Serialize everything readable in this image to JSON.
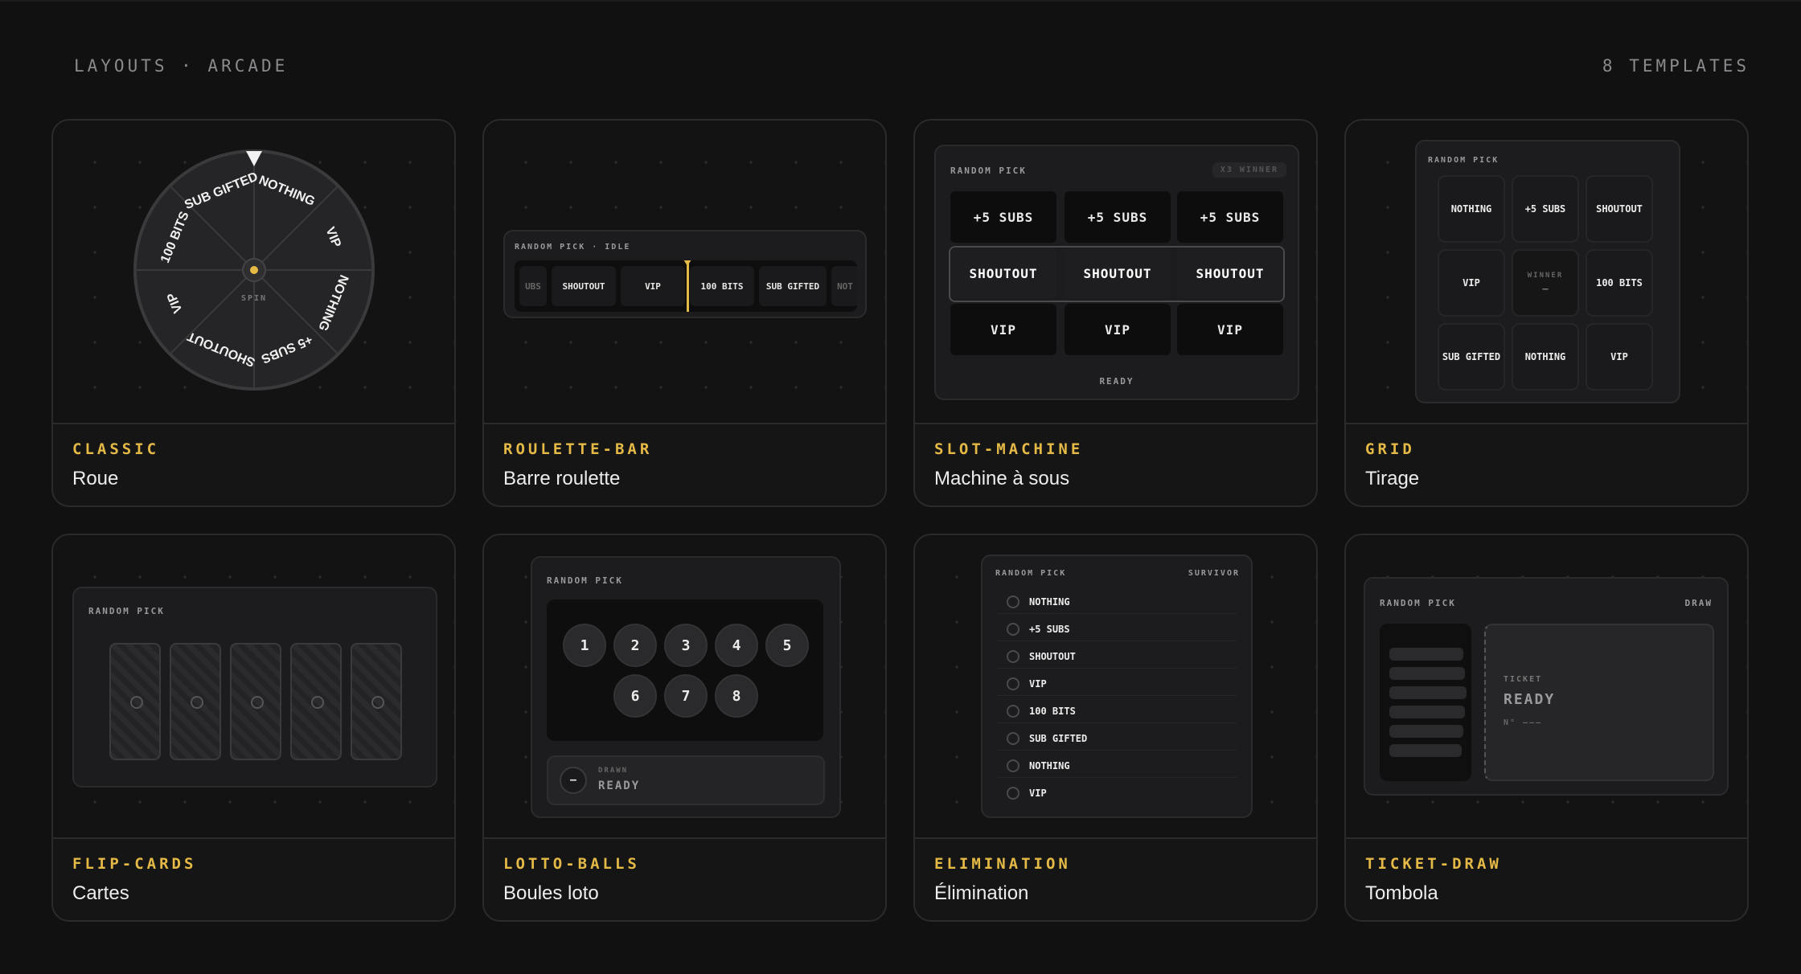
{
  "header": {
    "left": "LAYOUTS · ARCADE",
    "right": "8 TEMPLATES"
  },
  "cards": [
    {
      "tag": "CLASSIC",
      "title": "Roue"
    },
    {
      "tag": "ROULETTE-BAR",
      "title": "Barre roulette"
    },
    {
      "tag": "SLOT-MACHINE",
      "title": "Machine à sous"
    },
    {
      "tag": "GRID",
      "title": "Tirage"
    },
    {
      "tag": "FLIP-CARDS",
      "title": "Cartes"
    },
    {
      "tag": "LOTTO-BALLS",
      "title": "Boules loto"
    },
    {
      "tag": "ELIMINATION",
      "title": "Élimination"
    },
    {
      "tag": "TICKET-DRAW",
      "title": "Tombola"
    }
  ],
  "wheel": {
    "segments": [
      "NOTHING",
      "VIP",
      "NOTHING",
      "+5 SUBS",
      "SHOUTOUT",
      "VIP",
      "100 BITS",
      "SUB GIFTED"
    ],
    "center_label": "SPIN",
    "accent": "#e4b946"
  },
  "roulette": {
    "label": "RANDOM PICK · IDLE",
    "items": [
      "UBS",
      "SHOUTOUT",
      "VIP",
      "100 BITS",
      "SUB GIFTED",
      "NOT"
    ]
  },
  "slot": {
    "label": "RANDOM PICK",
    "badge": "X3 WINNER",
    "top": [
      "+5 SUBS",
      "+5 SUBS",
      "+5 SUBS"
    ],
    "middle": [
      "SHOUTOUT",
      "SHOUTOUT",
      "SHOUTOUT"
    ],
    "bottom": [
      "VIP",
      "VIP",
      "VIP"
    ],
    "status": "READY"
  },
  "grid": {
    "label": "RANDOM PICK",
    "cells": [
      "NOTHING",
      "+5 SUBS",
      "SHOUTOUT",
      "VIP",
      "",
      "100 BITS",
      "SUB GIFTED",
      "NOTHING",
      "VIP"
    ],
    "winner_label": "WINNER",
    "winner_value": "—"
  },
  "flip": {
    "label": "RANDOM PICK",
    "count": 5
  },
  "lotto": {
    "label": "RANDOM PICK",
    "balls": [
      "1",
      "2",
      "3",
      "4",
      "5",
      "6",
      "7",
      "8"
    ],
    "drawn_icon": "–",
    "drawn_label": "DRAWN",
    "drawn_value": "READY"
  },
  "elimination": {
    "label": "RANDOM PICK",
    "right": "SURVIVOR",
    "items": [
      "NOTHING",
      "+5 SUBS",
      "SHOUTOUT",
      "VIP",
      "100 BITS",
      "SUB GIFTED",
      "NOTHING",
      "VIP"
    ]
  },
  "ticket": {
    "label": "RANDOM PICK",
    "right": "DRAW",
    "ticket_label": "TICKET",
    "status": "READY",
    "number": "N° ———"
  }
}
